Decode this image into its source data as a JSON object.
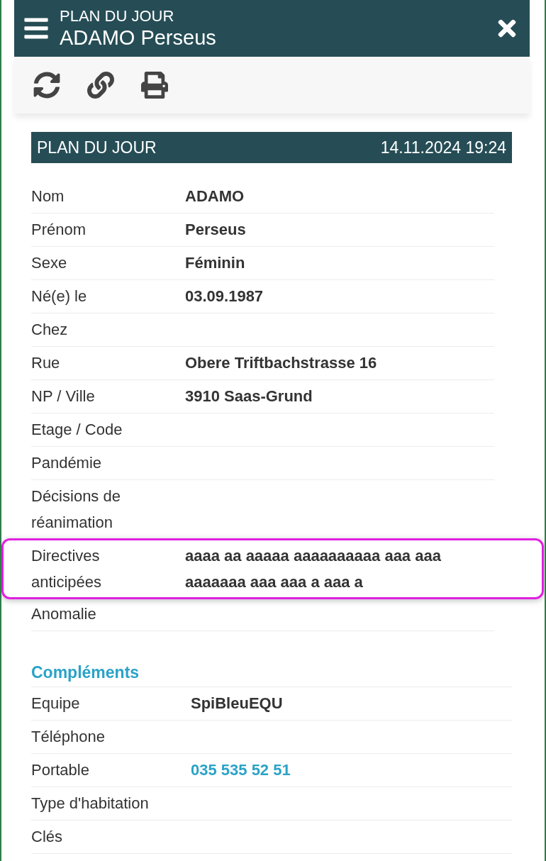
{
  "header": {
    "subtitle": "PLAN DU JOUR",
    "title": "ADAMO Perseus"
  },
  "toolbar": [
    {
      "kind": "refresh"
    },
    {
      "kind": "link"
    },
    {
      "kind": "print"
    }
  ],
  "banner": {
    "title": "PLAN DU JOUR",
    "timestamp": "14.11.2024 19:24"
  },
  "details": [
    {
      "label": "Nom",
      "value": "ADAMO",
      "highlighted": false
    },
    {
      "label": "Prénom",
      "value": "Perseus",
      "highlighted": false
    },
    {
      "label": "Sexe",
      "value": "Féminin",
      "highlighted": false
    },
    {
      "label": "Né(e) le",
      "value": "03.09.1987",
      "highlighted": false
    },
    {
      "label": "Chez",
      "highlighted": false
    },
    {
      "label": "Rue",
      "value": "Obere Triftbachstrasse 16",
      "highlighted": false
    },
    {
      "label": "NP / Ville",
      "value": "3910 Saas-Grund",
      "highlighted": false
    },
    {
      "label": "Etage / Code",
      "highlighted": false
    },
    {
      "label": "Pandémie",
      "highlighted": false
    },
    {
      "label": "Décisions de réanimation",
      "highlighted": false
    },
    {
      "label": "Directives anticipées",
      "value": "aaaa aa aaaaa aaaaaaaaaa aaa aaa aaaaaaa aaa aaa a aaa a",
      "highlighted": true
    },
    {
      "label": "Anomalie",
      "highlighted": false
    }
  ],
  "complements": {
    "title": "Compléments",
    "rows": [
      {
        "label": "Equipe",
        "value": "SpiBleuEQU",
        "kind": "text"
      },
      {
        "label": "Téléphone"
      },
      {
        "label": "Portable",
        "value": "035 535 52 51",
        "kind": "link"
      },
      {
        "label": "Type d'habitation"
      },
      {
        "label": "Clés"
      }
    ]
  }
}
